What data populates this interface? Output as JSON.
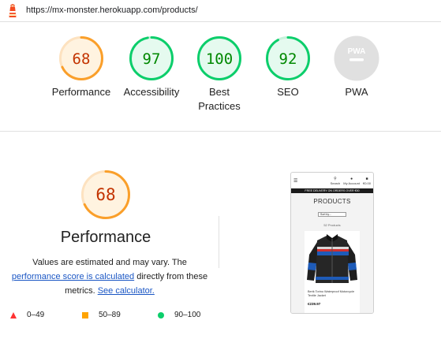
{
  "browser": {
    "url": "https://mx-monster.herokuapp.com/products/"
  },
  "colors": {
    "average": "#fa9f2a",
    "pass": "#0cce6b",
    "fail": "#ff3333",
    "na": "#e0e0e0",
    "link": "#1a56c4"
  },
  "gauges": [
    {
      "id": "performance",
      "score": "68",
      "value": 68,
      "label": "Performance",
      "status": "average"
    },
    {
      "id": "accessibility",
      "score": "97",
      "value": 97,
      "label": "Accessibility",
      "status": "pass"
    },
    {
      "id": "best-practices",
      "score": "100",
      "value": 100,
      "label_line1": "Best",
      "label_line2": "Practices",
      "status": "pass"
    },
    {
      "id": "seo",
      "score": "92",
      "value": 92,
      "label": "SEO",
      "status": "pass"
    },
    {
      "id": "pwa",
      "label": "PWA",
      "badge_text": "PWA",
      "status": "na"
    }
  ],
  "performance": {
    "score": "68",
    "value": 68,
    "title": "Performance",
    "desc_part1": "Values are estimated and may vary. The",
    "desc_link": "performance score is calculated",
    "desc_part2": "directly from these metrics.",
    "calc_link": "See calculator."
  },
  "legend": [
    {
      "range": "0–49",
      "shape": "triangle",
      "status": "fail"
    },
    {
      "range": "50–89",
      "shape": "square",
      "status": "average"
    },
    {
      "range": "90–100",
      "shape": "circle",
      "status": "pass"
    }
  ],
  "screenshot": {
    "search_label": "Search",
    "account_label": "My Account",
    "bag_total": "€0.00",
    "banner": "FREE DELIVERY ON ORDERS OVER €50",
    "page_title": "PRODUCTS",
    "sort_label": "Sort by...",
    "count": "52 Products",
    "product_name": "Berik Torino Waterproof Motorcycle Textile Jacket",
    "product_price": "€239.97"
  }
}
